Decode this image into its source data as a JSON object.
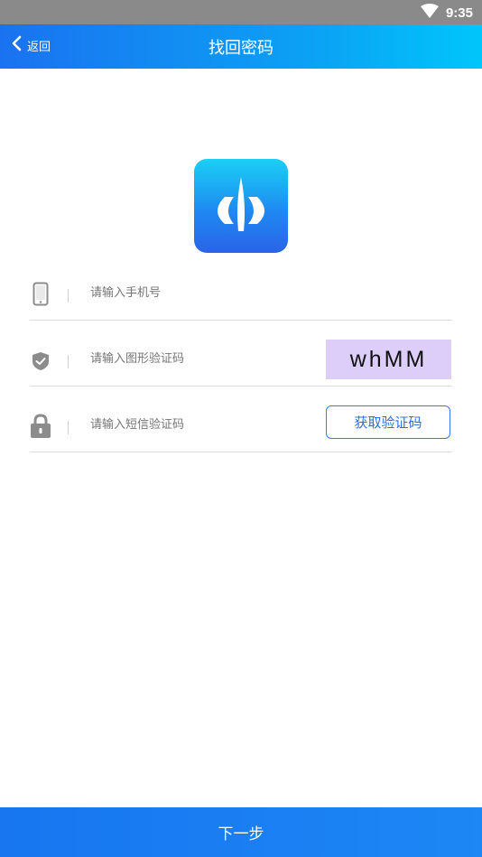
{
  "status_bar": {
    "time": "9:35",
    "icons": [
      "wifi-icon"
    ]
  },
  "header": {
    "back_label": "返回",
    "title": "找回密码",
    "back_icon": "chevron-left-icon"
  },
  "logo": {
    "icon": "app-logo-icon"
  },
  "form": {
    "phone": {
      "placeholder": "请输入手机号",
      "icon": "phone-icon"
    },
    "captcha": {
      "placeholder": "请输入图形验证码",
      "icon": "shield-check-icon",
      "captcha_text": "whMM"
    },
    "sms": {
      "placeholder": "请输入短信验证码",
      "icon": "lock-icon",
      "button_label": "获取验证码"
    }
  },
  "footer": {
    "next_label": "下一步"
  },
  "colors": {
    "accent": "#1e7ef2",
    "header_end": "#00c6fb",
    "captcha_bg": "#dccef8"
  }
}
